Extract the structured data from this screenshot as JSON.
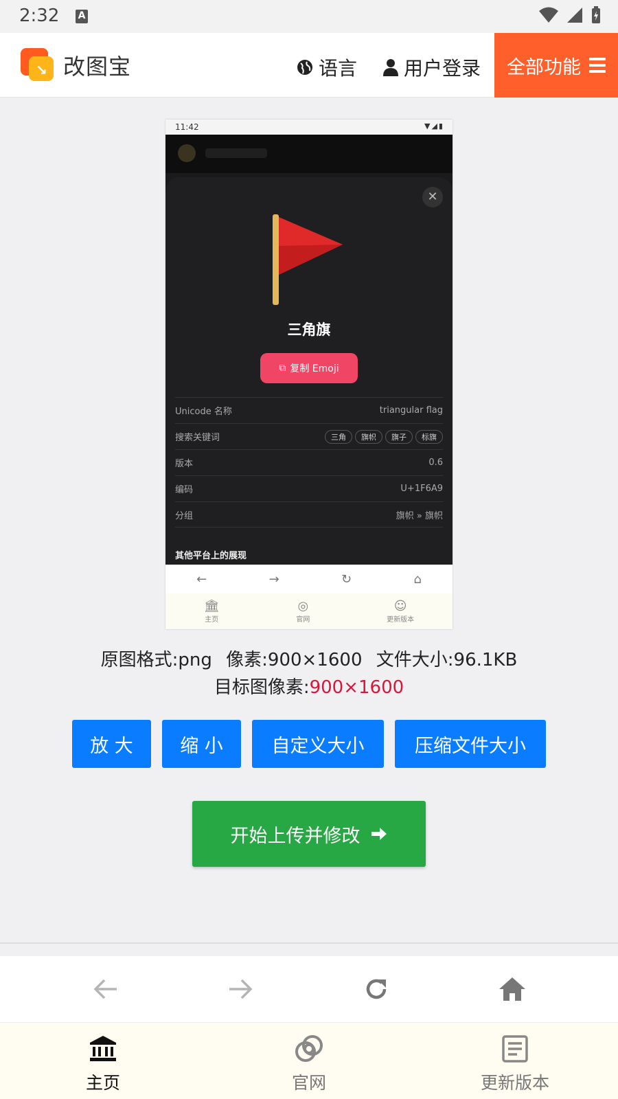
{
  "status_bar": {
    "time": "2:32",
    "a_icon": "A"
  },
  "header": {
    "brand": "改图宝",
    "language": "语言",
    "login": "用户登录",
    "all_functions": "全部功能"
  },
  "preview": {
    "status_time": "11:42",
    "emoji_name": "三角旗",
    "copy_label": "复制 Emoji",
    "rows": [
      {
        "label": "Unicode 名称",
        "value": "triangular flag"
      },
      {
        "label": "搜索关键词",
        "tags": [
          "三角",
          "旗帜",
          "旗子",
          "标旗"
        ]
      },
      {
        "label": "版本",
        "value": "0.6"
      },
      {
        "label": "编码",
        "value": "U+1F6A9"
      },
      {
        "label": "分组",
        "value": "旗帜 » 旗帜"
      }
    ],
    "other_platforms": "其他平台上的展现",
    "tabs": [
      "主页",
      "官网",
      "更新版本"
    ]
  },
  "info": {
    "format": "原图格式:png",
    "pixels": "像素:900×1600",
    "filesize": "文件大小:96.1KB",
    "target_label": "目标图像素:",
    "target_value": "900×1600"
  },
  "actions": {
    "zoom_in": "放 大",
    "zoom_out": "缩 小",
    "custom_size": "自定义大小",
    "compress": "压缩文件大小",
    "upload": "开始上传并修改"
  },
  "bottom_tabs": [
    {
      "label": "主页",
      "icon": "bank-icon",
      "active": true
    },
    {
      "label": "官网",
      "icon": "rings-icon",
      "active": false
    },
    {
      "label": "更新版本",
      "icon": "document-icon",
      "active": false
    }
  ],
  "colors": {
    "accent_orange": "#ff5f2a",
    "button_blue": "#0a7cff",
    "button_green": "#28a745",
    "highlight_red": "#dc143c"
  }
}
